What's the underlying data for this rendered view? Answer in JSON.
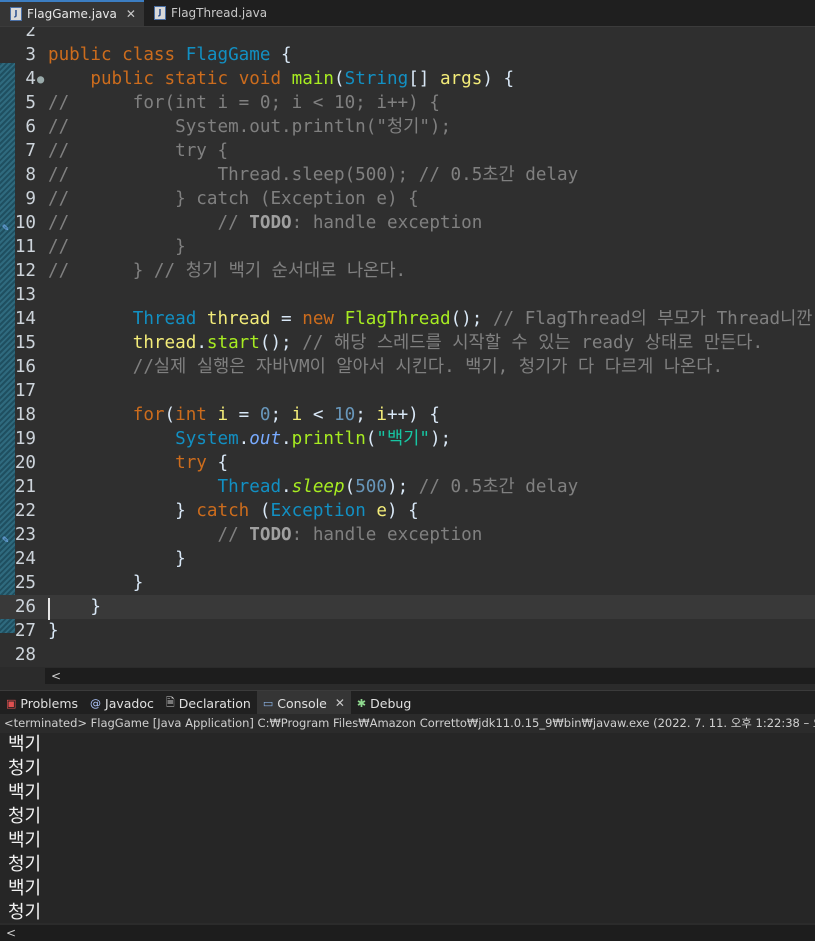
{
  "tabs": [
    {
      "label": "FlagGame.java",
      "active": true
    },
    {
      "label": "FlagThread.java",
      "active": false
    }
  ],
  "editor": {
    "line_numbers": [
      "2",
      "3",
      "4",
      "5",
      "6",
      "7",
      "8",
      "9",
      "10",
      "11",
      "12",
      "13",
      "14",
      "15",
      "16",
      "17",
      "18",
      "19",
      "20",
      "21",
      "22",
      "23",
      "24",
      "25",
      "26",
      "27",
      "28"
    ],
    "lines": [
      "",
      "public class FlagGame {",
      "    public static void main(String[] args) {",
      "//      for(int i = 0; i < 10; i++) {",
      "//          System.out.println(\"청기\");",
      "//          try {",
      "//              Thread.sleep(500); // 0.5초간 delay",
      "//          } catch (Exception e) {",
      "//              // TODO: handle exception",
      "//          }",
      "//      } // 청기 백기 순서대로 나온다.",
      "",
      "        Thread thread = new FlagThread(); // FlagThread의 부모가 Thread니깐",
      "        thread.start(); // 해당 스레드를 시작할 수 있는 ready 상태로 만든다.",
      "        //실제 실행은 자바VM이 알아서 시킨다. 백기, 청기가 다 다르게 나온다.",
      "",
      "        for(int i = 0; i < 10; i++) {",
      "            System.out.println(\"백기\");",
      "            try {",
      "                Thread.sleep(500); // 0.5초간 delay",
      "            } catch (Exception e) {",
      "                // TODO: handle exception",
      "            }",
      "        }",
      "    }",
      "}",
      ""
    ]
  },
  "panel": {
    "tabs": [
      {
        "label": "Problems",
        "icon": "problems-icon",
        "active": false
      },
      {
        "label": "Javadoc",
        "icon": "javadoc-icon",
        "active": false
      },
      {
        "label": "Declaration",
        "icon": "declaration-icon",
        "active": false
      },
      {
        "label": "Console",
        "icon": "console-icon",
        "active": true
      },
      {
        "label": "Debug",
        "icon": "debug-icon",
        "active": false
      }
    ],
    "status": "<terminated> FlagGame [Java Application] C:₩Program Files₩Amazon Corretto₩jdk11.0.15_9₩bin₩javaw.exe  (2022. 7. 11. 오후 1:22:38 – 오후 1:22",
    "output": [
      "백기",
      "청기",
      "백기",
      "청기",
      "백기",
      "청기",
      "백기",
      "청기"
    ]
  },
  "scroll_left_glyph": "<"
}
